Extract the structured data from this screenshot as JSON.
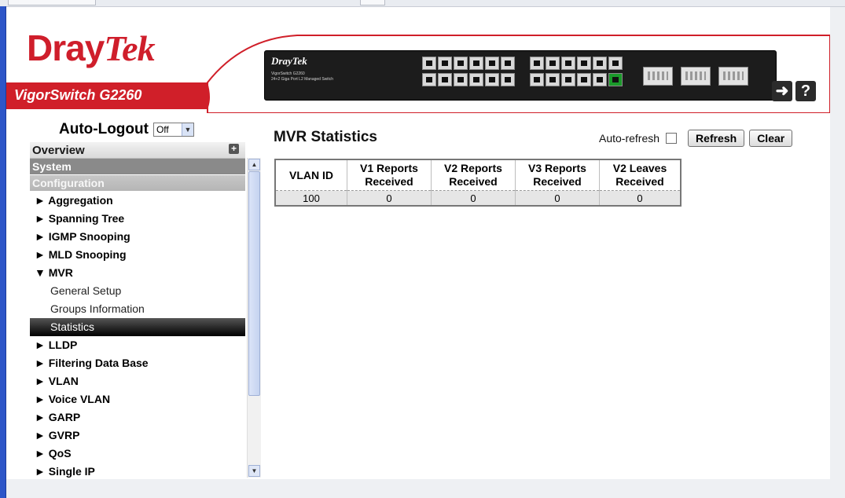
{
  "header": {
    "logo_dray": "Dray",
    "logo_tek": "Tek",
    "model": "VigorSwitch G2260",
    "device_logo": "DrayTek",
    "device_sub": "VigorSwitch G2260\n24+2 Giga Port L2 Managed Switch",
    "logout_icon": "logout-arrow-icon",
    "help_icon": "help-question-icon",
    "brand_color": "#d01f29"
  },
  "auto_logout": {
    "label": "Auto-Logout",
    "value": "Off"
  },
  "sidebar": {
    "overview": "Overview",
    "system": "System",
    "configuration": "Configuration",
    "items": [
      {
        "label": "► Aggregation"
      },
      {
        "label": "► Spanning Tree"
      },
      {
        "label": "► IGMP Snooping"
      },
      {
        "label": "► MLD Snooping"
      },
      {
        "label": "▼ MVR"
      }
    ],
    "mvr_sub": [
      {
        "label": "General Setup"
      },
      {
        "label": "Groups Information"
      },
      {
        "label": "Statistics"
      }
    ],
    "items_after": [
      {
        "label": "► LLDP"
      },
      {
        "label": "► Filtering Data Base"
      },
      {
        "label": "► VLAN"
      },
      {
        "label": "► Voice VLAN"
      },
      {
        "label": "► GARP"
      },
      {
        "label": "► GVRP"
      },
      {
        "label": "► QoS"
      },
      {
        "label": "► Single IP"
      }
    ]
  },
  "main": {
    "title": "MVR Statistics",
    "auto_refresh_label": "Auto-refresh",
    "auto_refresh_checked": false,
    "refresh_label": "Refresh",
    "clear_label": "Clear",
    "table": {
      "headers": [
        [
          "VLAN ID"
        ],
        [
          "V1 Reports",
          "Received"
        ],
        [
          "V2 Reports",
          "Received"
        ],
        [
          "V3 Reports",
          "Received"
        ],
        [
          "V2 Leaves",
          "Received"
        ]
      ],
      "rows": [
        [
          "100",
          "0",
          "0",
          "0",
          "0"
        ]
      ]
    }
  }
}
